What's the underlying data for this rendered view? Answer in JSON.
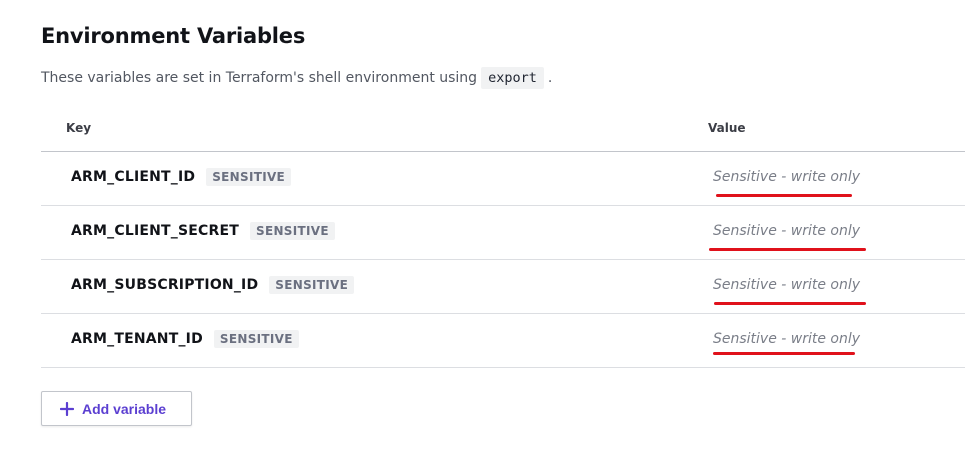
{
  "section": {
    "title": "Environment Variables",
    "description_before": "These variables are set in Terraform's shell environment using",
    "description_code": "export",
    "description_after": "."
  },
  "table": {
    "headers": {
      "key": "Key",
      "value": "Value"
    },
    "rows": [
      {
        "key": "ARM_CLIENT_ID",
        "badge": "SENSITIVE",
        "value": "Sensitive - write only"
      },
      {
        "key": "ARM_CLIENT_SECRET",
        "badge": "SENSITIVE",
        "value": "Sensitive - write only"
      },
      {
        "key": "ARM_SUBSCRIPTION_ID",
        "badge": "SENSITIVE",
        "value": "Sensitive - write only"
      },
      {
        "key": "ARM_TENANT_ID",
        "badge": "SENSITIVE",
        "value": "Sensitive - write only"
      }
    ]
  },
  "actions": {
    "add_variable_label": "Add variable"
  },
  "colors": {
    "accent": "#5b3fd1",
    "annotation": "#e0111b"
  }
}
